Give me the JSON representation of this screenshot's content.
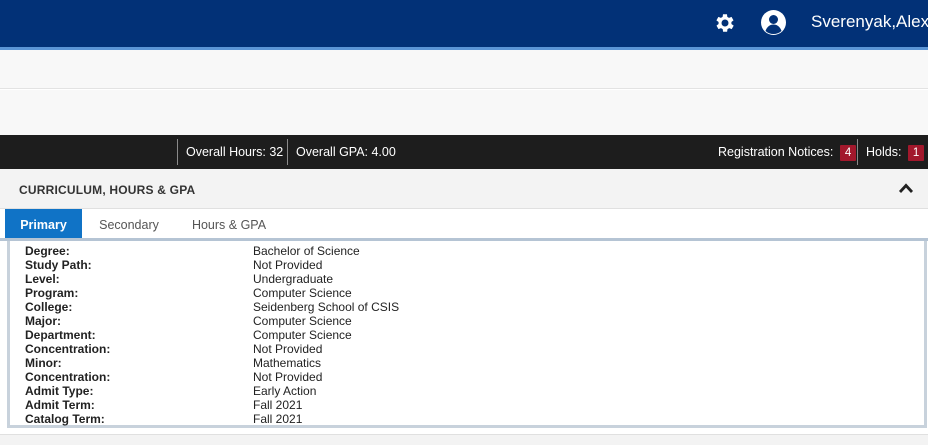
{
  "header": {
    "username": "Sverenyak,Alex",
    "settings_icon": "gear-icon",
    "user_icon": "user-avatar-icon",
    "bar_color": "#023177"
  },
  "stats": {
    "overall_hours": "Overall Hours: 32",
    "overall_gpa": "Overall GPA: 4.00",
    "registration_notices_label": "Registration Notices:",
    "registration_notices_count": "4",
    "holds_label": "Holds:",
    "holds_count": "1",
    "badge_color": "#a2182c"
  },
  "section": {
    "title": "CURRICULUM, HOURS & GPA",
    "collapse_icon": "chevron-up-icon"
  },
  "tabs": [
    {
      "label": "Primary",
      "active": true
    },
    {
      "label": "Secondary",
      "active": false
    },
    {
      "label": "Hours & GPA",
      "active": false
    }
  ],
  "curriculum": [
    {
      "label": "Degree:",
      "value": "Bachelor of Science"
    },
    {
      "label": "Study Path:",
      "value": "Not Provided"
    },
    {
      "label": "Level:",
      "value": "Undergraduate"
    },
    {
      "label": "Program:",
      "value": "Computer Science"
    },
    {
      "label": "College:",
      "value": "Seidenberg School of CSIS"
    },
    {
      "label": "Major:",
      "value": "Computer Science"
    },
    {
      "label": "Department:",
      "value": "Computer Science"
    },
    {
      "label": "Concentration:",
      "value": "Not Provided"
    },
    {
      "label": "Minor:",
      "value": "Mathematics"
    },
    {
      "label": "Concentration:",
      "value": "Not Provided"
    },
    {
      "label": "Admit Type:",
      "value": "Early Action"
    },
    {
      "label": "Admit Term:",
      "value": "Fall 2021"
    },
    {
      "label": "Catalog Term:",
      "value": "Fall 2021"
    }
  ]
}
